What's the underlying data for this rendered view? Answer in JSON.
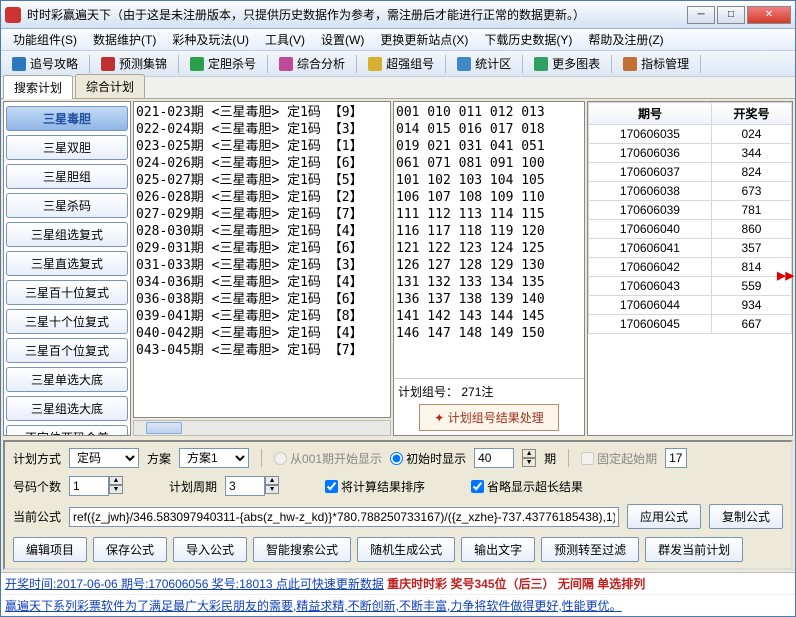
{
  "title": "时时彩赢遍天下（由于这是未注册版本，只提供历史数据作为参考，需注册后才能进行正常的数据更新。）",
  "menu": [
    "功能组件(S)",
    "数据维护(T)",
    "彩种及玩法(U)",
    "工具(V)",
    "设置(W)",
    "更换更新站点(X)",
    "下载历史数据(Y)",
    "帮助及注册(Z)"
  ],
  "toolbar": [
    {
      "label": "追号攻略",
      "icon": "#2a78c0"
    },
    {
      "label": "预测集锦",
      "icon": "#c03030"
    },
    {
      "label": "定胆杀号",
      "icon": "#2aa04a"
    },
    {
      "label": "综合分析",
      "icon": "#c04a9a"
    },
    {
      "label": "超强组号",
      "icon": "#d6b030"
    },
    {
      "label": "统计区",
      "icon": "#4088c8"
    },
    {
      "label": "更多图表",
      "icon": "#30a060"
    },
    {
      "label": "指标管理",
      "icon": "#c07030"
    }
  ],
  "tabs": [
    "搜索计划",
    "综合计划"
  ],
  "sidebar": [
    "三星毒胆",
    "三星双胆",
    "三星胆组",
    "三星杀码",
    "三星组选复式",
    "三星直选复式",
    "三星百十位复式",
    "三星十个位复式",
    "三星百个位复式",
    "三星单选大底",
    "三星组选大底",
    "不定位两码合差"
  ],
  "list1": [
    "021-023期 <三星毒胆> 定1码 【9】",
    "022-024期 <三星毒胆> 定1码 【3】",
    "023-025期 <三星毒胆> 定1码 【1】",
    "024-026期 <三星毒胆> 定1码 【6】",
    "025-027期 <三星毒胆> 定1码 【5】",
    "026-028期 <三星毒胆> 定1码 【2】",
    "027-029期 <三星毒胆> 定1码 【7】",
    "028-030期 <三星毒胆> 定1码 【4】",
    "029-031期 <三星毒胆> 定1码 【6】",
    "031-033期 <三星毒胆> 定1码 【3】",
    "034-036期 <三星毒胆> 定1码 【4】",
    "036-038期 <三星毒胆> 定1码 【6】",
    "039-041期 <三星毒胆> 定1码 【8】",
    "040-042期 <三星毒胆> 定1码 【4】",
    "043-045期 <三星毒胆> 定1码 【7】"
  ],
  "list2": [
    "001 010 011 012 013",
    "014 015 016 017 018",
    "019 021 031 041 051",
    "061 071 081 091 100",
    "101 102 103 104 105",
    "106 107 108 109 110",
    "111 112 113 114 115",
    "116 117 118 119 120",
    "121 122 123 124 125",
    "126 127 128 129 130",
    "131 132 133 134 135",
    "136 137 138 139 140",
    "141 142 143 144 145",
    "146 147 148 149 150"
  ],
  "group_count_label": "计划组号：",
  "group_count_value": "271注",
  "group_result_btn": "计划组号结果处理",
  "table": {
    "headers": [
      "期号",
      "开奖号"
    ],
    "rows": [
      [
        "170606035",
        "024"
      ],
      [
        "170606036",
        "344"
      ],
      [
        "170606037",
        "824"
      ],
      [
        "170606038",
        "673"
      ],
      [
        "170606039",
        "781"
      ],
      [
        "170606040",
        "860"
      ],
      [
        "170606041",
        "357"
      ],
      [
        "170606042",
        "814"
      ],
      [
        "170606043",
        "559"
      ],
      [
        "170606044",
        "934"
      ],
      [
        "170606045",
        "667"
      ]
    ]
  },
  "form": {
    "plan_mode_label": "计划方式",
    "plan_mode_value": "定码",
    "scheme_label": "方案",
    "scheme_value": "方案1",
    "radio1": "从001期开始显示",
    "radio2": "初始时显示",
    "period_num": "40",
    "period_suffix": "期",
    "fixed_start": "固定起始期",
    "fixed_start_val": "17",
    "num_count_label": "号码个数",
    "num_count_value": "1",
    "cycle_label": "计划周期",
    "cycle_value": "3",
    "sort_label": "将计算结果排序",
    "omit_label": "省略显示超长结果",
    "formula_label": "当前公式",
    "formula_value": "ref({z_jwh}/346.583097940311-{abs(z_hw-z_kd)}*780.788250733167)/({z_xzhe}-737.43776185438),1)",
    "apply_btn": "应用公式",
    "copy_btn": "复制公式"
  },
  "btns": [
    "编辑项目",
    "保存公式",
    "导入公式",
    "智能搜索公式",
    "随机生成公式",
    "输出文字",
    "预测转至过滤",
    "群发当前计划"
  ],
  "status1_link": "开奖时间:2017-06-06 期号:170606056 奖号:18013 点此可快速更新数据",
  "status1_red": "重庆时时彩  奖号345位（后三）  无间隔  单选排列",
  "status2": "赢遍天下系列彩票软件为了满足最广大彩民朋友的需要,精益求精,不断创新,不断丰富,力争将软件做得更好,性能更优。"
}
